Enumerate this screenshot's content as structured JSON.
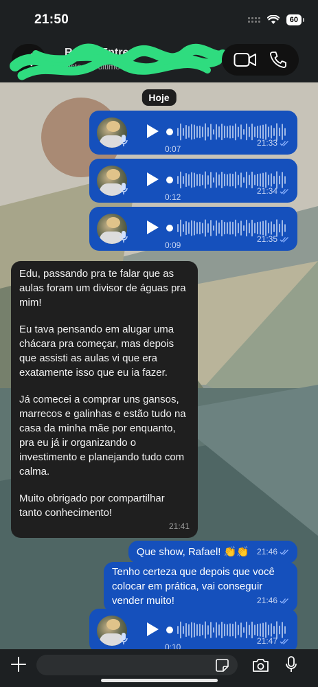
{
  "status_bar": {
    "time": "21:50",
    "battery": "60"
  },
  "header": {
    "contact_name": "Rafael Entregas",
    "contact_status": "visto por último às 21:21"
  },
  "date_chip": "Hoje",
  "messages": {
    "voice_1": {
      "duration": "0:07",
      "time": "21:33"
    },
    "voice_2": {
      "duration": "0:12",
      "time": "21:34"
    },
    "voice_3": {
      "duration": "0:09",
      "time": "21:35"
    },
    "incoming_text": {
      "paragraphs": [
        "Edu, passando pra te falar que as aulas foram um divisor de águas pra mim!",
        "Eu tava pensando em alugar uma chácara pra começar, mas depois que assisti as aulas vi que era exatamente isso que eu ia fazer.",
        "Já comecei a comprar uns gansos, marrecos e galinhas e estão tudo na casa da minha mãe por enquanto, pra eu já ir organizando o investimento e planejando tudo com calma.",
        "Muito obrigado por compartilhar tanto conhecimento!"
      ],
      "time": "21:41"
    },
    "reply_1": {
      "text": "Que show, Rafael! 👏👏",
      "time": "21:46"
    },
    "reply_2": {
      "text": "Tenho certeza que depois que você colocar em prática, vai conseguir vender muito!",
      "time": "21:46"
    },
    "voice_4": {
      "duration": "0:10",
      "time": "21:47"
    }
  },
  "input": {
    "placeholder": ""
  },
  "colors": {
    "outgoing_bubble": "#1550bc",
    "incoming_bubble": "#1f1f1f",
    "bar_background": "#1d2022",
    "read_ticks": "#8fb4ff"
  },
  "icons": [
    "back-icon",
    "video-call-icon",
    "phone-icon",
    "play-icon",
    "mic-icon",
    "plus-icon",
    "sticker-icon",
    "camera-icon"
  ]
}
